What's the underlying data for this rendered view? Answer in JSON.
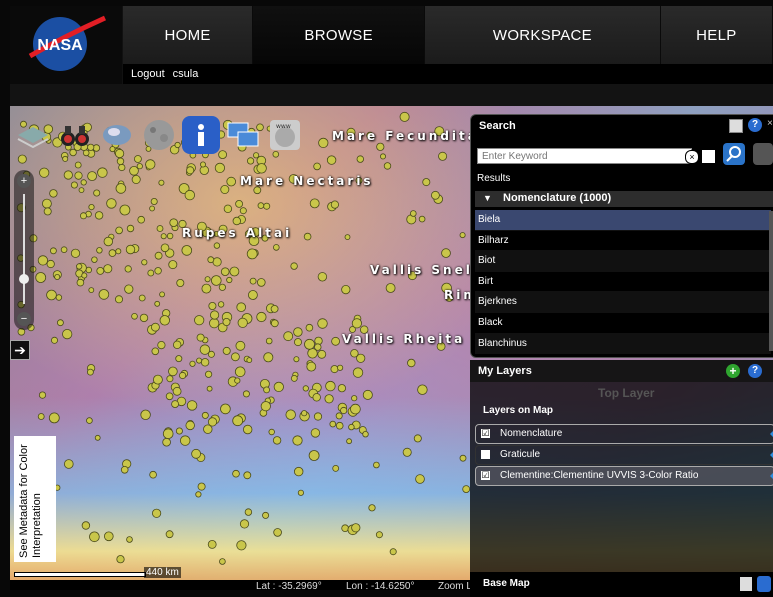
{
  "header": {
    "logo_text": "NASA",
    "nav": [
      "HOME",
      "BROWSE",
      "WORKSPACE",
      "HELP"
    ],
    "logout": "Logout",
    "username": "csula"
  },
  "map": {
    "labels": [
      "Mare Fecundita",
      "Mare Nectaris",
      "Rupes Altai",
      "Vallis Snell",
      "Rim",
      "Vallis Rheita"
    ],
    "meta_note": "See Metadata for Color Interpretation",
    "scale": "440 km",
    "lat": "Lat :  -35.2969°",
    "lon": "Lon :  -14.6250°",
    "zoom": "Zoom L"
  },
  "search": {
    "title": "Search",
    "placeholder": "Enter Keyword",
    "results_label": "Results",
    "group": "Nomenclature (1000)",
    "results": [
      "Biela",
      "Bilharz",
      "Biot",
      "Birt",
      "Bjerknes",
      "Black",
      "Blanchinus"
    ]
  },
  "layers": {
    "title": "My Layers",
    "top_layer": "Top Layer",
    "on_map": "Layers on Map",
    "items": [
      {
        "name": "Nomenclature",
        "checked": "☑"
      },
      {
        "name": "Graticule",
        "checked": ""
      },
      {
        "name": "Clementine:Clementine UVVIS 3-Color Ratio",
        "checked": "☑"
      }
    ],
    "base_map": "Base Map"
  },
  "colors": {
    "accent": "#2c8de0",
    "selected_row": "#3a4870",
    "crater_fill": "#c9c64a"
  }
}
